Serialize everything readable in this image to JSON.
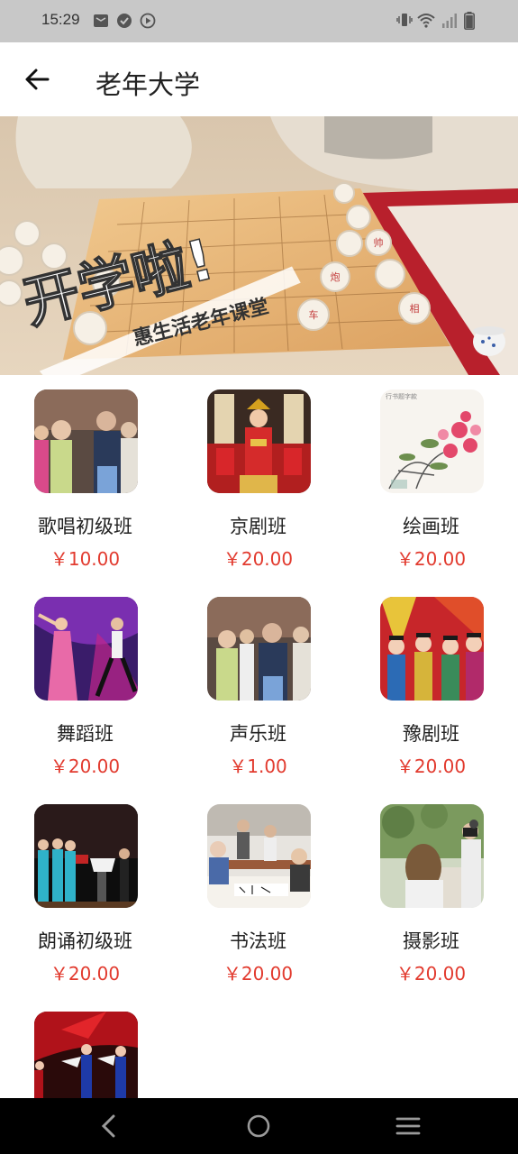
{
  "status_bar": {
    "time": "15:29",
    "icons": [
      "mail-icon",
      "check-circle-icon",
      "play-circle-icon",
      "vibrate-icon",
      "wifi-icon",
      "signal-icon",
      "battery-icon"
    ]
  },
  "app_bar": {
    "title": "老年大学",
    "back_icon": "arrow-left-icon"
  },
  "banner": {
    "headline": "开学啦!",
    "subline": "惠生活老年课堂"
  },
  "courses": [
    {
      "name": "歌唱初级班",
      "price": "￥10.00"
    },
    {
      "name": "京剧班",
      "price": "￥20.00"
    },
    {
      "name": "绘画班",
      "price": "￥20.00"
    },
    {
      "name": "舞蹈班",
      "price": "￥20.00"
    },
    {
      "name": "声乐班",
      "price": "￥1.00"
    },
    {
      "name": "豫剧班",
      "price": "￥20.00"
    },
    {
      "name": "朗诵初级班",
      "price": "￥20.00"
    },
    {
      "name": "书法班",
      "price": "￥20.00"
    },
    {
      "name": "摄影班",
      "price": "￥20.00"
    },
    {
      "name": "",
      "price": ""
    }
  ],
  "colors": {
    "price": "#e23b2f",
    "status_bar": "#c8c8c8",
    "nav_bar": "#000000"
  },
  "nav_bar": {
    "icons": [
      "back-triangle-icon",
      "home-circle-icon",
      "menu-lines-icon"
    ]
  }
}
